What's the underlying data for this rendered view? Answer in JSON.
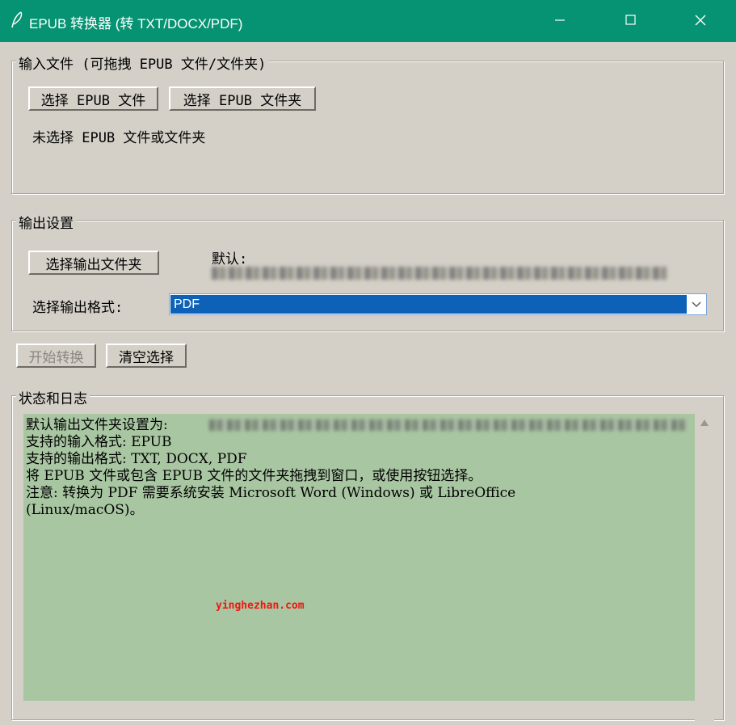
{
  "window": {
    "title": "EPUB 转换器 (转 TXT/DOCX/PDF)",
    "icon": "feather-icon",
    "controls": [
      "minimize-icon",
      "maximize-icon",
      "close-icon"
    ]
  },
  "input_group": {
    "label": "输入文件 (可拖拽 EPUB 文件/文件夹)",
    "select_file_button": "选择 EPUB 文件",
    "select_folder_button": "选择 EPUB 文件夹",
    "status": "未选择 EPUB 文件或文件夹"
  },
  "output_group": {
    "label": "输出设置",
    "select_output_button": "选择输出文件夹",
    "default_label": "默认:",
    "format_label": "选择输出格式:",
    "format_value": "PDF"
  },
  "actions": {
    "start_button": "开始转换",
    "clear_button": "清空选择"
  },
  "log_group": {
    "label": "状态和日志",
    "lines": [
      "默认输出文件夹设置为:",
      "支持的输入格式: EPUB",
      "支持的输出格式: TXT, DOCX, PDF",
      "将 EPUB 文件或包含 EPUB 文件的文件夹拖拽到窗口，或使用按钮选择。",
      "注意: 转换为 PDF 需要系统安装 Microsoft Word (Windows) 或 LibreOffice",
      "(Linux/macOS)。"
    ],
    "watermark": "yinghezhan.com"
  },
  "colors": {
    "titlebar": "#069373",
    "window_bg": "#d4d0c8",
    "log_bg": "#a9c6a2",
    "selection": "#0d62b8",
    "watermark": "#f0160e"
  }
}
